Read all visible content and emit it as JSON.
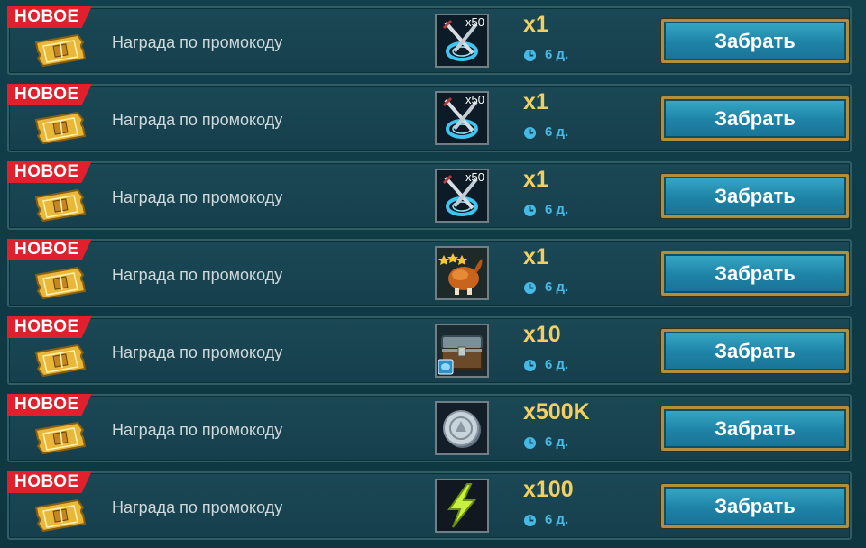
{
  "rewards": [
    {
      "badge": "НОВОЕ",
      "label": "Награда по промокоду",
      "icon": "swords-portal-icon",
      "icon_qty": "x50",
      "qty": "x1",
      "timer": "6 д.",
      "button": "Забрать"
    },
    {
      "badge": "НОВОЕ",
      "label": "Награда по промокоду",
      "icon": "swords-portal-icon",
      "icon_qty": "x50",
      "qty": "x1",
      "timer": "6 д.",
      "button": "Забрать"
    },
    {
      "badge": "НОВОЕ",
      "label": "Награда по промокоду",
      "icon": "swords-portal-icon",
      "icon_qty": "x50",
      "qty": "x1",
      "timer": "6 д.",
      "button": "Забрать"
    },
    {
      "badge": "НОВОЕ",
      "label": "Награда по промокоду",
      "icon": "roast-chicken-icon",
      "icon_qty": "",
      "qty": "x1",
      "timer": "6 д.",
      "button": "Забрать"
    },
    {
      "badge": "НОВОЕ",
      "label": "Награда по промокоду",
      "icon": "treasure-chest-icon",
      "icon_qty": "",
      "qty": "x10",
      "timer": "6 д.",
      "button": "Забрать"
    },
    {
      "badge": "НОВОЕ",
      "label": "Награда по промокоду",
      "icon": "silver-coin-icon",
      "icon_qty": "",
      "qty": "x500K",
      "timer": "6 д.",
      "button": "Забрать"
    },
    {
      "badge": "НОВОЕ",
      "label": "Награда по промокоду",
      "icon": "energy-bolt-icon",
      "icon_qty": "",
      "qty": "x100",
      "timer": "6 д.",
      "button": "Забрать"
    }
  ],
  "colors": {
    "badge": "#e0202c",
    "quantity": "#f2cf62",
    "timer": "#46b9e6",
    "button_border": "#b38f3c",
    "button_fill": "#2a93b6"
  }
}
